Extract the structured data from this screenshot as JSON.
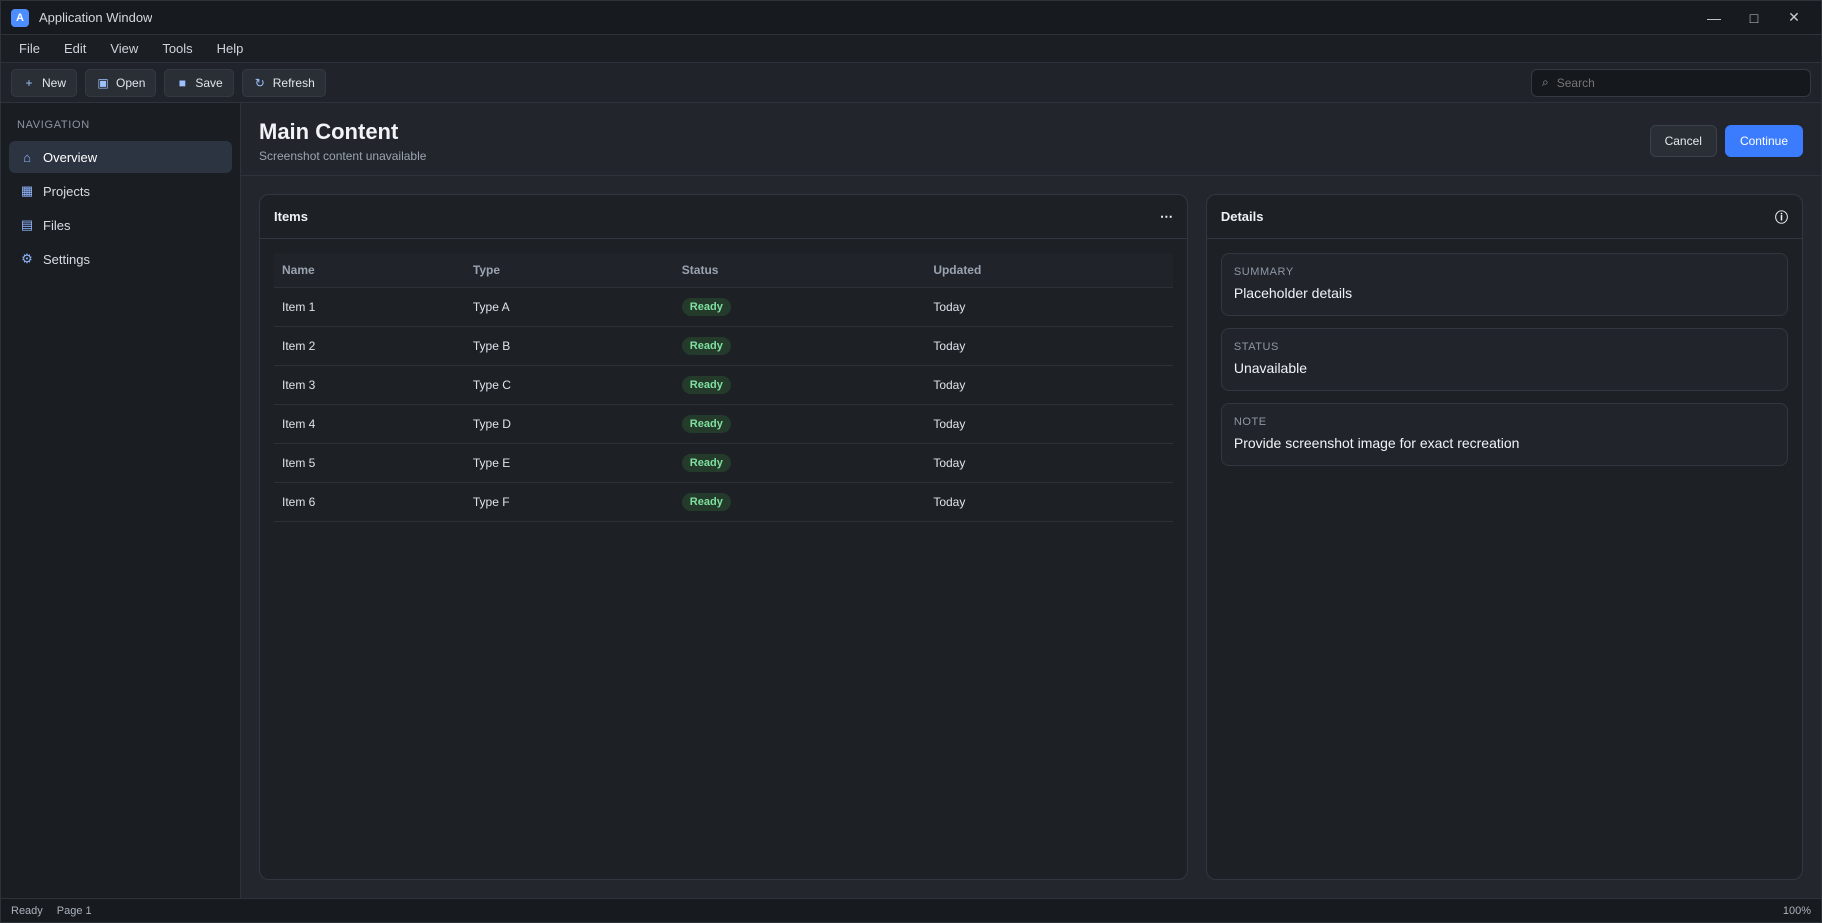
{
  "window": {
    "title": "Application Window",
    "app_icon": "A"
  },
  "menu": [
    "File",
    "Edit",
    "View",
    "Tools",
    "Help"
  ],
  "toolbar": {
    "buttons": [
      {
        "label": "New",
        "icon": "plus-icon",
        "glyph": "+"
      },
      {
        "label": "Open",
        "icon": "folder-icon",
        "glyph": "▣"
      },
      {
        "label": "Save",
        "icon": "save-icon",
        "glyph": "■"
      },
      {
        "label": "Refresh",
        "icon": "refresh-icon",
        "glyph": "↻"
      }
    ],
    "search_placeholder": "Search"
  },
  "sidebar": {
    "heading": "Navigation",
    "items": [
      {
        "label": "Overview",
        "icon": "home-icon",
        "glyph": "⌂",
        "active": true
      },
      {
        "label": "Projects",
        "icon": "grid-icon",
        "glyph": "▦",
        "active": false
      },
      {
        "label": "Files",
        "icon": "file-icon",
        "glyph": "▤",
        "active": false
      },
      {
        "label": "Settings",
        "icon": "gear-icon",
        "glyph": "⚙",
        "active": false
      }
    ]
  },
  "content": {
    "title": "Main Content",
    "subtitle": "Screenshot content unavailable",
    "primary_action": "Continue",
    "secondary_action": "Cancel"
  },
  "table": {
    "title": "Items",
    "columns": [
      "Name",
      "Type",
      "Status",
      "Updated"
    ],
    "rows": [
      [
        "Item 1",
        "Type A",
        "Ready",
        "Today"
      ],
      [
        "Item 2",
        "Type B",
        "Ready",
        "Today"
      ],
      [
        "Item 3",
        "Type C",
        "Ready",
        "Today"
      ],
      [
        "Item 4",
        "Type D",
        "Ready",
        "Today"
      ],
      [
        "Item 5",
        "Type E",
        "Ready",
        "Today"
      ],
      [
        "Item 6",
        "Type F",
        "Ready",
        "Today"
      ]
    ]
  },
  "details": {
    "title": "Details",
    "cards": [
      {
        "label": "Summary",
        "value": "Placeholder details"
      },
      {
        "label": "Status",
        "value": "Unavailable"
      },
      {
        "label": "Note",
        "value": "Provide screenshot image for exact recreation"
      }
    ]
  },
  "statusbar": {
    "left": "Ready",
    "middle": "Page 1",
    "right": "100%"
  },
  "colors": {
    "accent": "#3b7cff"
  }
}
